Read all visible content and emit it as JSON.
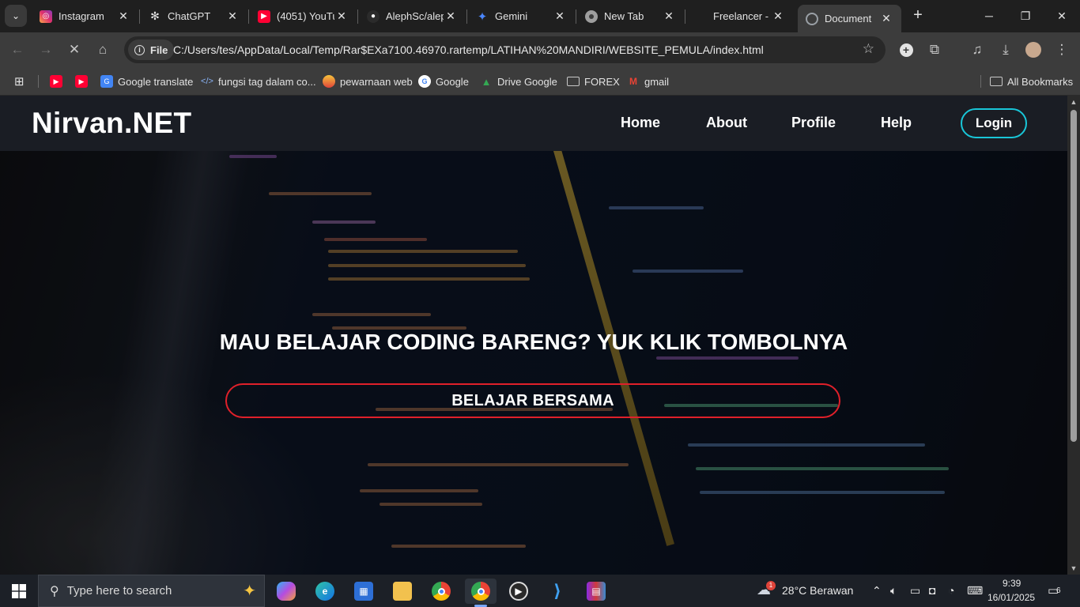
{
  "browser": {
    "tabs": [
      {
        "title": "Instagram",
        "icon": "instagram-icon",
        "color": "#e1306c"
      },
      {
        "title": "ChatGPT",
        "icon": "chatgpt-icon",
        "color": "#3c3c3c"
      },
      {
        "title": "(4051) YouTu",
        "icon": "youtube-icon",
        "color": "#ff0033"
      },
      {
        "title": "AlephSc/alep",
        "icon": "github-icon",
        "color": "#3c3c3c"
      },
      {
        "title": "Gemini",
        "icon": "gemini-icon",
        "color": "#4a86ff"
      },
      {
        "title": "New Tab",
        "icon": "chrome-icon",
        "color": "#3c3c3c"
      },
      {
        "title": "Freelancer - ",
        "icon": "freelancer-icon",
        "color": "#29b2fe"
      },
      {
        "title": "Document",
        "icon": "document-icon",
        "color": "#5f6368"
      }
    ],
    "address": {
      "scheme_label": "File",
      "url": "C:/Users/tes/AppData/Local/Temp/Rar$EXa7100.46970.rartemp/LATIHAN%20MANDIRI/WEBSITE_PEMULA/index.html"
    },
    "bookmarks": [
      {
        "label": "",
        "icon": "youtube-icon"
      },
      {
        "label": "",
        "icon": "youtube-icon"
      },
      {
        "label": "Google translate",
        "icon": "google-translate-icon"
      },
      {
        "label": "fungsi tag dalam co...",
        "icon": "code-icon"
      },
      {
        "label": "pewarnaan web",
        "icon": "paint-icon"
      },
      {
        "label": "Google",
        "icon": "google-icon"
      },
      {
        "label": "Drive Google",
        "icon": "drive-icon"
      },
      {
        "label": "FOREX",
        "icon": "folder-icon"
      },
      {
        "label": "gmail",
        "icon": "gmail-icon"
      }
    ],
    "all_bookmarks_label": "All Bookmarks"
  },
  "page": {
    "logo": "Nirvan.NET",
    "nav": [
      "Home",
      "About",
      "Profile",
      "Help"
    ],
    "login_label": "Login",
    "hero_title": "MAU BELAJAR CODING BARENG? YUK KLIK TOMBOLNYA",
    "hero_button": "BELAJAR BERSAMA",
    "accent_cyan": "#19c6d8",
    "accent_red": "#e0202a"
  },
  "taskbar": {
    "search_placeholder": "Type here to search",
    "weather": "28°C  Berawan",
    "time": "9:39",
    "date": "16/01/2025",
    "notification_count": "6",
    "weather_badge": "1"
  }
}
